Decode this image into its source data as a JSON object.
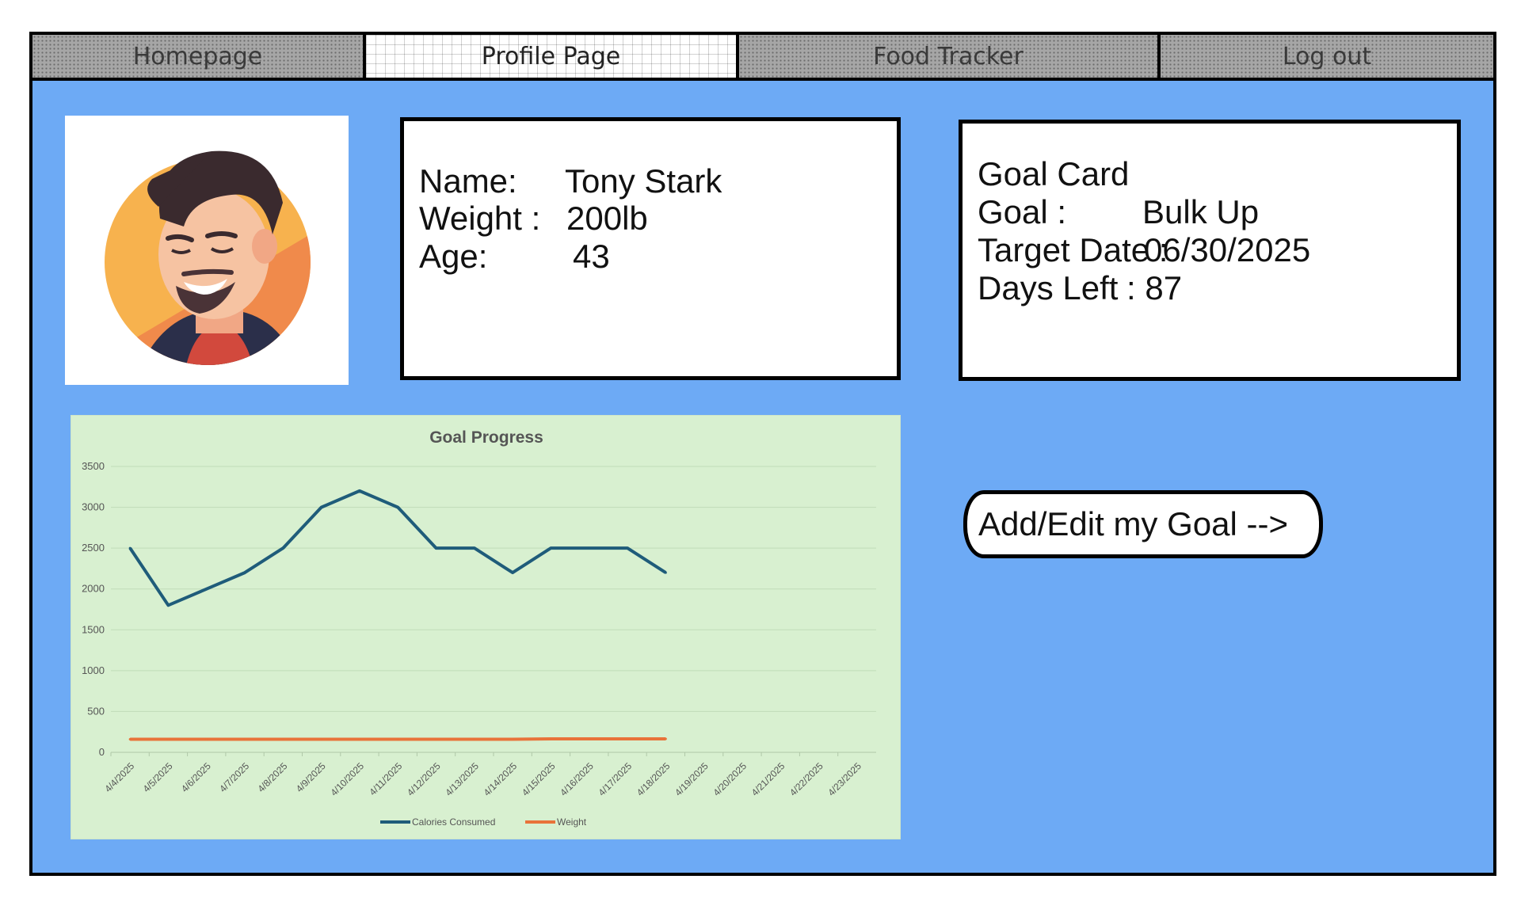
{
  "nav": {
    "tabs": [
      {
        "label": "Homepage"
      },
      {
        "label": "Profile Page"
      },
      {
        "label": "Food Tracker"
      },
      {
        "label": "Log out"
      }
    ]
  },
  "profile": {
    "name_label": "Name:",
    "name_value": "Tony Stark",
    "weight_label": "Weight :",
    "weight_value": "200lb",
    "age_label": "Age:",
    "age_value": "43"
  },
  "goal_card": {
    "title": "Goal Card",
    "goal_label": "Goal :",
    "goal_value": "Bulk Up",
    "target_label": "Target Date :",
    "target_value": "06/30/2025",
    "days_label": "Days Left",
    "days_value": ": 87"
  },
  "goal_button": {
    "label": "Add/Edit my Goal -->"
  },
  "colors": {
    "frame_bg": "#6daaf5",
    "chart_bg": "#d8f0d0",
    "calories_line": "#1f5c7a",
    "weight_line": "#e8733a"
  },
  "chart_data": {
    "type": "line",
    "title": "Goal Progress",
    "categories": [
      "4/4/2025",
      "4/5/2025",
      "4/6/2025",
      "4/7/2025",
      "4/8/2025",
      "4/9/2025",
      "4/10/2025",
      "4/11/2025",
      "4/12/2025",
      "4/13/2025",
      "4/14/2025",
      "4/15/2025",
      "4/16/2025",
      "4/17/2025",
      "4/18/2025",
      "4/19/2025",
      "4/20/2025",
      "4/21/2025",
      "4/22/2025",
      "4/23/2025"
    ],
    "series": [
      {
        "name": "Calories Consumed",
        "color": "#1f5c7a",
        "values": [
          2500,
          1800,
          2000,
          2200,
          2500,
          3000,
          3200,
          3000,
          2500,
          2500,
          2200,
          2500,
          2500,
          2500,
          2200,
          null,
          null,
          null,
          null,
          null
        ]
      },
      {
        "name": "Weight",
        "color": "#e8733a",
        "values": [
          160,
          160,
          160,
          160,
          160,
          160,
          160,
          160,
          160,
          160,
          160,
          165,
          165,
          165,
          165,
          null,
          null,
          null,
          null,
          null
        ]
      }
    ],
    "ylim": [
      0,
      3500
    ],
    "yticks": [
      0,
      500,
      1000,
      1500,
      2000,
      2500,
      3000,
      3500
    ],
    "grid": true,
    "legend": "bottom"
  }
}
